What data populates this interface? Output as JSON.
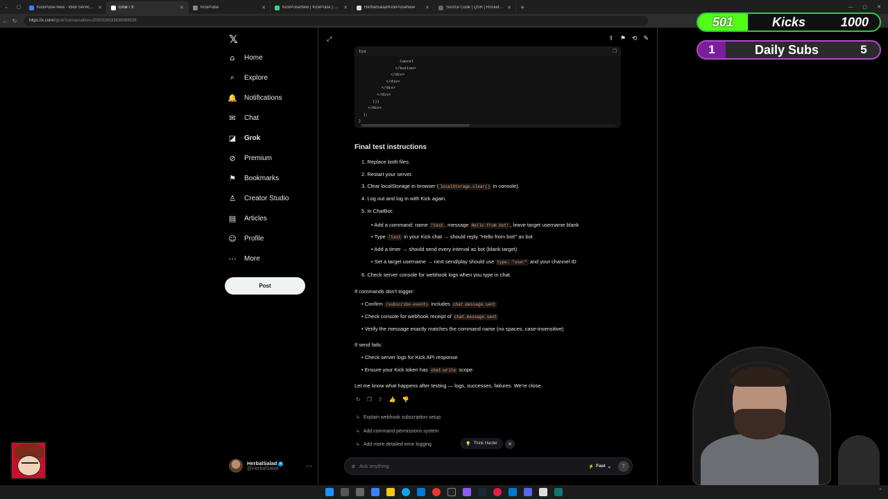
{
  "browser": {
    "tabs": [
      {
        "title": "KickPulse-New - Web Service - Re",
        "color": "#3b82f6",
        "active": false
      },
      {
        "title": "Grok / X",
        "color": "#ffffff",
        "active": true
      },
      {
        "title": "KickPulse",
        "color": "#888888",
        "active": false
      },
      {
        "title": "KickPulseNew | KickPulse | Supab",
        "color": "#3ecf8e",
        "active": false
      },
      {
        "title": "HerbalSalad/KickPulseNew",
        "color": "#dddddd",
        "active": false
      },
      {
        "title": "Source Code | QSR | Rocket Pos",
        "color": "#666666",
        "active": false
      }
    ],
    "url_host": "https://x.com/",
    "url_path": "i/grok?conversation=2030326033636069528"
  },
  "sidebar": {
    "logo": "𝕏",
    "items": [
      {
        "label": "Home",
        "icon": "⌂",
        "name": "home-icon",
        "bold": false
      },
      {
        "label": "Explore",
        "icon": "⌕",
        "name": "search-icon",
        "bold": false
      },
      {
        "label": "Notifications",
        "icon": "🔔",
        "name": "bell-icon",
        "bold": false
      },
      {
        "label": "Chat",
        "icon": "✉",
        "name": "mail-icon",
        "bold": false
      },
      {
        "label": "Grok",
        "icon": "◪",
        "name": "grok-icon",
        "bold": true
      },
      {
        "label": "Premium",
        "icon": "⊘",
        "name": "premium-icon",
        "bold": false
      },
      {
        "label": "Bookmarks",
        "icon": "⚑",
        "name": "bookmark-icon",
        "bold": false
      },
      {
        "label": "Creator Studio",
        "icon": "♙",
        "name": "creator-icon",
        "bold": false
      },
      {
        "label": "Articles",
        "icon": "▤",
        "name": "articles-icon",
        "bold": false
      },
      {
        "label": "Profile",
        "icon": "☺",
        "name": "profile-icon",
        "bold": false
      },
      {
        "label": "More",
        "icon": "⋯",
        "name": "more-icon",
        "bold": false
      }
    ],
    "post_label": "Post",
    "user": {
      "name": "HerbalSalad",
      "handle": "@HerbalSalad",
      "verified_mark": "✓",
      "more": "···"
    }
  },
  "main": {
    "code": {
      "lang": "tsx",
      "lines": [
        "                  Cancel",
        "                </button>",
        "              </div>",
        "            </div>",
        "          </div>",
        "        </div>",
        "      ))}",
        "    </div>",
        "  );",
        "}"
      ]
    },
    "heading": "Final test instructions",
    "steps": [
      {
        "n": "1.",
        "parts": [
          {
            "t": "Replace both files."
          }
        ]
      },
      {
        "n": "2.",
        "parts": [
          {
            "t": "Restart your server."
          }
        ]
      },
      {
        "n": "3.",
        "parts": [
          {
            "t": "Clear localStorage in browser ("
          },
          {
            "c": "localStorage.clear()"
          },
          {
            "t": " in console)."
          }
        ]
      },
      {
        "n": "4.",
        "parts": [
          {
            "t": "Log out and log in with Kick again."
          }
        ]
      },
      {
        "n": "5.",
        "parts": [
          {
            "t": "In ChatBot:"
          }
        ]
      }
    ],
    "chatbot_bullets": [
      {
        "parts": [
          {
            "t": "Add a command: name "
          },
          {
            "c": "!test"
          },
          {
            "t": ", message "
          },
          {
            "c": "Hello from bot!"
          },
          {
            "t": ", leave target username blank"
          }
        ]
      },
      {
        "parts": [
          {
            "t": "Type "
          },
          {
            "c": "!test"
          },
          {
            "t": " in your Kick chat → should reply \"Hello from bot!\" as bot"
          }
        ]
      },
      {
        "parts": [
          {
            "t": "Add a timer → should send every interval as bot (blank target)"
          }
        ]
      },
      {
        "parts": [
          {
            "t": "Set a target username → next send/play should use "
          },
          {
            "c": "type: \"user\""
          },
          {
            "t": " and your channel ID"
          }
        ]
      }
    ],
    "step6": {
      "n": "6.",
      "parts": [
        {
          "t": "Check server console for webhook logs when you type in chat."
        }
      ]
    },
    "if_commands_label": "If commands don't trigger:",
    "commands_bullets": [
      {
        "parts": [
          {
            "t": "Confirm "
          },
          {
            "c": "/subscribe-events"
          },
          {
            "t": " includes "
          },
          {
            "c": "chat.message.sent"
          }
        ]
      },
      {
        "parts": [
          {
            "t": "Check console for webhook receipt of "
          },
          {
            "c": "chat.message.sent"
          }
        ]
      },
      {
        "parts": [
          {
            "t": "Verify the message exactly matches the command name (no spaces, case-insensitive)"
          }
        ]
      }
    ],
    "if_send_label": "If send fails:",
    "send_bullets": [
      {
        "parts": [
          {
            "t": "Check server logs for Kick API response"
          }
        ]
      },
      {
        "parts": [
          {
            "t": "Ensure your Kick token has "
          },
          {
            "c": "chat:write"
          },
          {
            "t": " scope"
          }
        ]
      }
    ],
    "closing": "Let me know what happens after testing — logs, successes, failures. We're close.",
    "suggestions": [
      "Explain webhook subscription setup",
      "Add command permissions system",
      "Add more detailed error logging"
    ],
    "think_harder": "Think Harder",
    "input_placeholder": "Ask anything",
    "mode": "Fast"
  },
  "overlay": {
    "kicks_count": "501",
    "kicks_label": "Kicks",
    "kicks_goal": "1000",
    "subs_count": "1",
    "subs_label": "Daily Subs",
    "subs_goal": "5",
    "kicks_color": "#53fc18",
    "subs_color": "#b44ad2"
  }
}
